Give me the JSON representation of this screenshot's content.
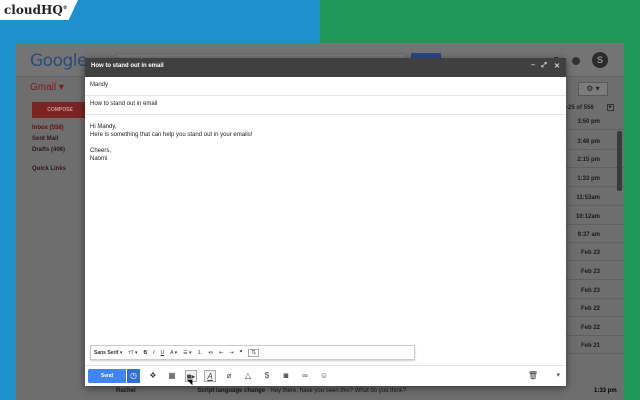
{
  "brand": {
    "name": "cloudHQ",
    "mark": "®"
  },
  "gmail": {
    "google_logo": "Google",
    "label": "Gmail",
    "compose_label": "COMPOSE",
    "nav": [
      {
        "label": "Inbox (558)"
      },
      {
        "label": "Sent Mail"
      },
      {
        "label": "Drafts (406)"
      },
      {
        "label": "Quick Links"
      }
    ],
    "avatar_letter": "S",
    "pager": "-25 of 558",
    "times": [
      "3:50 pm",
      "3:46 pm",
      "2:15 pm",
      "1:33 pm",
      "11:53am",
      "10:12am",
      "9:37 am",
      "Feb 23",
      "Feb 23",
      "Feb 23",
      "Feb 22",
      "Feb 22",
      "Feb 21",
      "1:33 pm"
    ],
    "bottom_row": {
      "sender": "Rachel",
      "subject": "Script language change",
      "snippet": " - Hey there, have you seen this? What do you think?"
    }
  },
  "compose": {
    "title": "How to stand out in email",
    "to": "Mandy",
    "subject": "How to stand out in email",
    "body_lines": [
      "Hi Mandy,",
      "Here is something that can help you stand out in your emails!",
      "",
      "Cheers,",
      "Naomi"
    ],
    "format_toolbar": {
      "font": "Sans Serif"
    },
    "send_label": "Send"
  },
  "colors": {
    "left_bg": "#1f8fd0",
    "right_bg": "#1e9958",
    "send": "#4285f4",
    "header": "#404040"
  }
}
